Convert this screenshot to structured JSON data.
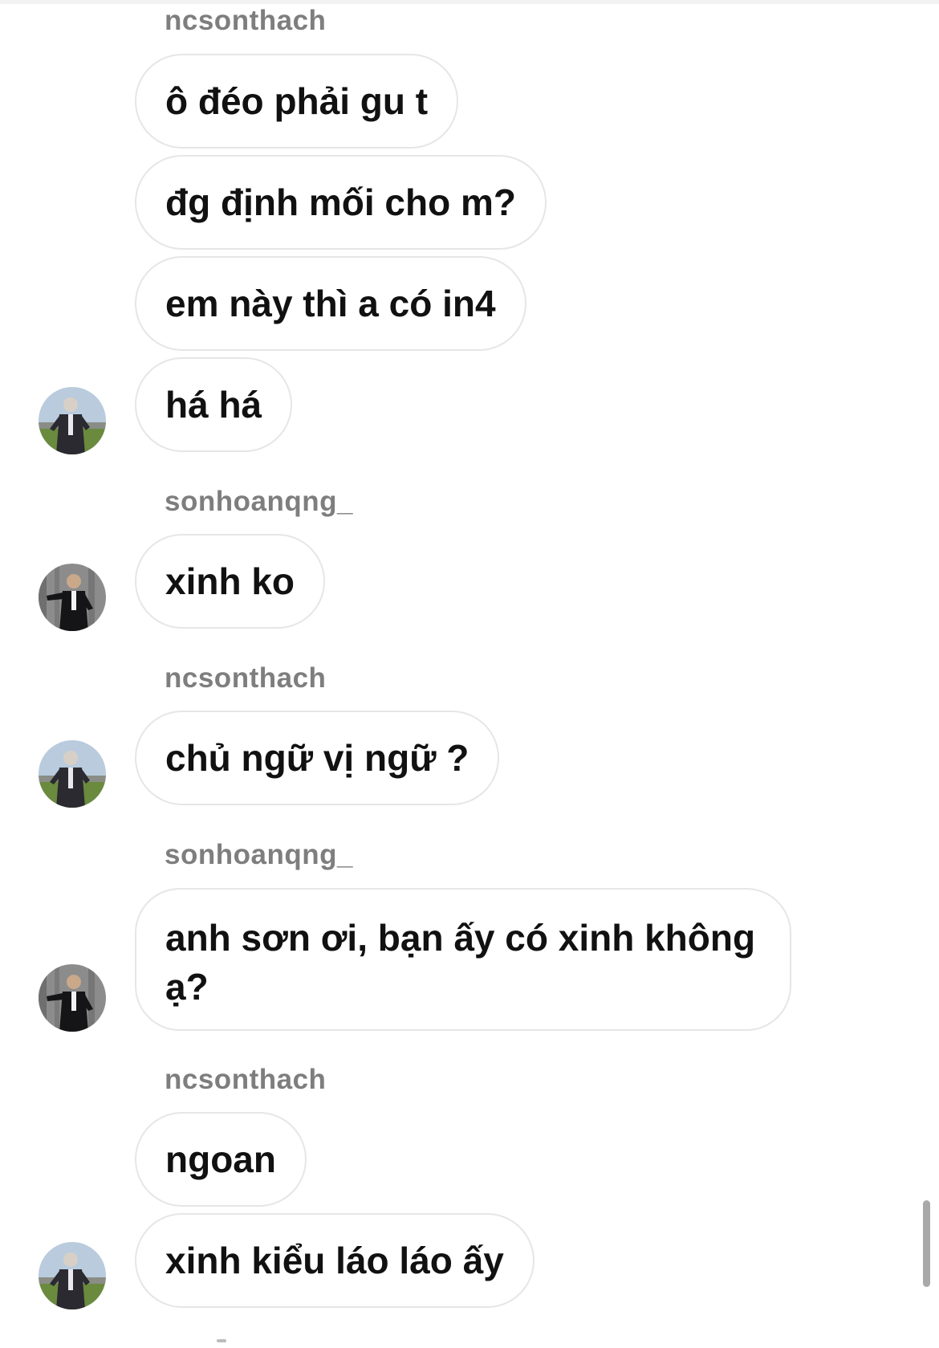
{
  "thread": {
    "senders": {
      "ncsonthach": "ncsonthach",
      "sonhoanqng": "sonhoanqng_"
    },
    "messages": [
      {
        "sender": "ncsonthach",
        "text": "ô đéo phải gu t"
      },
      {
        "sender": "ncsonthach",
        "text": "đg định mối cho m?"
      },
      {
        "sender": "ncsonthach",
        "text": "em này thì a có in4"
      },
      {
        "sender": "ncsonthach",
        "text": "há há"
      },
      {
        "sender": "sonhoanqng_",
        "text": "xinh ko"
      },
      {
        "sender": "ncsonthach",
        "text": "chủ ngữ vị ngữ ?"
      },
      {
        "sender": "sonhoanqng_",
        "text": "anh sơn ơi, bạn ấy có xinh không ạ?"
      },
      {
        "sender": "ncsonthach",
        "text": "ngoan"
      },
      {
        "sender": "ncsonthach",
        "text": "xinh kiểu láo láo ấy"
      }
    ]
  },
  "icons": {
    "avatar_ncsonthach": "avatar-ncsonthach-icon",
    "avatar_sonhoanqng": "avatar-sonhoanqng-icon"
  },
  "colors": {
    "background": "#ffffff",
    "bubble_border": "#e6e6e6",
    "text": "#111111",
    "sender_name": "#7e7e7e",
    "scrollbar": "#a9a9a9"
  }
}
